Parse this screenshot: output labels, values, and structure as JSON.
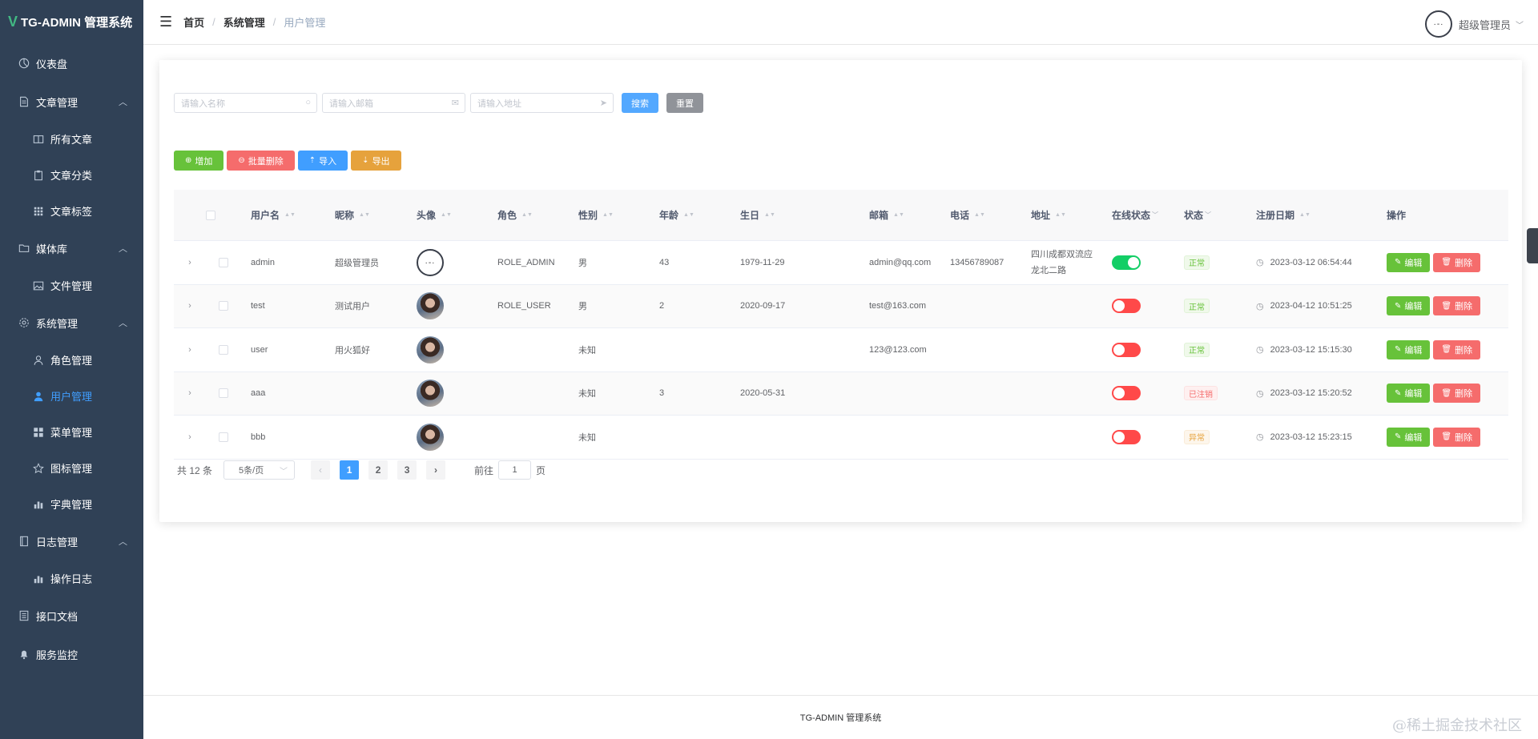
{
  "app": {
    "logo_mark": "V",
    "title": "TG-ADMIN 管理系统"
  },
  "sidebar": {
    "items": [
      {
        "label": "仪表盘",
        "icon": "dashboard-icon"
      },
      {
        "label": "文章管理",
        "icon": "document-icon"
      },
      {
        "label": "所有文章",
        "icon": "book-icon"
      },
      {
        "label": "文章分类",
        "icon": "clipboard-icon"
      },
      {
        "label": "文章标签",
        "icon": "grid-icon"
      },
      {
        "label": "媒体库",
        "icon": "folder-icon"
      },
      {
        "label": "文件管理",
        "icon": "image-icon"
      },
      {
        "label": "系统管理",
        "icon": "gear-icon"
      },
      {
        "label": "角色管理",
        "icon": "user-outline-icon"
      },
      {
        "label": "用户管理",
        "icon": "user-icon"
      },
      {
        "label": "菜单管理",
        "icon": "menu-grid-icon"
      },
      {
        "label": "图标管理",
        "icon": "star-icon"
      },
      {
        "label": "字典管理",
        "icon": "bar-chart-icon"
      },
      {
        "label": "日志管理",
        "icon": "notebook-icon"
      },
      {
        "label": "操作日志",
        "icon": "bar-chart-icon"
      },
      {
        "label": "接口文档",
        "icon": "doc-list-icon"
      },
      {
        "label": "服务监控",
        "icon": "bell-icon"
      }
    ]
  },
  "header": {
    "breadcrumb": [
      "首页",
      "系统管理",
      "用户管理"
    ],
    "username": "超级管理员"
  },
  "search": {
    "name_placeholder": "请输入名称",
    "email_placeholder": "请输入邮箱",
    "address_placeholder": "请输入地址",
    "search_label": "搜索",
    "reset_label": "重置"
  },
  "toolbar": {
    "add": "增加",
    "batch_delete": "批量删除",
    "import": "导入",
    "export": "导出"
  },
  "table": {
    "headers": [
      "用户名",
      "昵称",
      "头像",
      "角色",
      "性别",
      "年龄",
      "生日",
      "邮箱",
      "电话",
      "地址",
      "在线状态",
      "状态",
      "注册日期",
      "操作"
    ],
    "rows": [
      {
        "username": "admin",
        "nickname": "超级管理员",
        "role": "ROLE_ADMIN",
        "gender": "男",
        "age": "43",
        "birthday": "1979-11-29",
        "email": "admin@qq.com",
        "phone": "13456789087",
        "address1": "四川成都双流应",
        "address2": "龙北二路",
        "online": true,
        "status": "正常",
        "created": "2023-03-12 06:54:44"
      },
      {
        "username": "test",
        "nickname": "测试用户",
        "role": "ROLE_USER",
        "gender": "男",
        "age": "2",
        "birthday": "2020-09-17",
        "email": "test@163.com",
        "phone": "",
        "address1": "",
        "address2": "",
        "online": false,
        "status": "正常",
        "created": "2023-04-12 10:51:25"
      },
      {
        "username": "user",
        "nickname": "用火狐好",
        "role": "",
        "gender": "未知",
        "age": "",
        "birthday": "",
        "email": "123@123.com",
        "phone": "",
        "address1": "",
        "address2": "",
        "online": false,
        "status": "正常",
        "created": "2023-03-12 15:15:30"
      },
      {
        "username": "aaa",
        "nickname": "",
        "role": "",
        "gender": "未知",
        "age": "3",
        "birthday": "2020-05-31",
        "email": "",
        "phone": "",
        "address1": "",
        "address2": "",
        "online": false,
        "status": "已注销",
        "created": "2023-03-12 15:20:52"
      },
      {
        "username": "bbb",
        "nickname": "",
        "role": "",
        "gender": "未知",
        "age": "",
        "birthday": "",
        "email": "",
        "phone": "",
        "address1": "",
        "address2": "",
        "online": false,
        "status": "异常",
        "created": "2023-03-12 15:23:15"
      }
    ],
    "edit_label": "编辑",
    "delete_label": "删除"
  },
  "pagination": {
    "total": "共 12 条",
    "page_size": "5条/页",
    "pages": [
      "1",
      "2",
      "3"
    ],
    "current": "1",
    "goto_prefix": "前往",
    "goto_value": "1",
    "goto_suffix": "页"
  },
  "footer": {
    "text": "TG-ADMIN 管理系统"
  },
  "watermark": "@稀土掘金技术社区",
  "colors": {
    "sidebar_bg": "#304156",
    "primary": "#409eff",
    "success": "#67c23a",
    "danger": "#f56c6c",
    "warning": "#e6a23c",
    "switch_on": "#13ce66",
    "switch_off": "#ff4949"
  }
}
